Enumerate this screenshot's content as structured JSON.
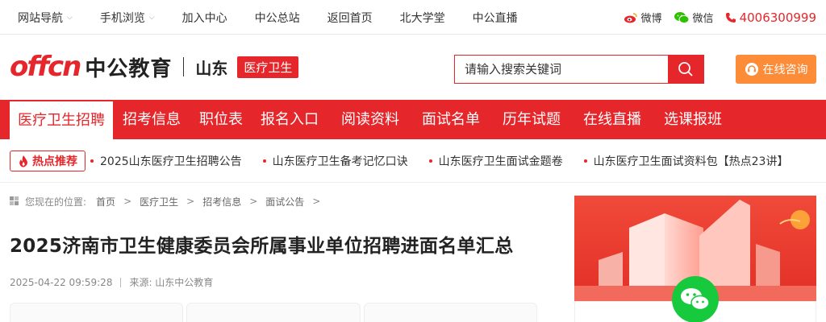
{
  "topbar": {
    "nav": [
      {
        "label": "网站导航",
        "dropdown": true
      },
      {
        "label": "手机浏览",
        "dropdown": true
      },
      {
        "label": "加入中心",
        "dropdown": false
      },
      {
        "label": "中公总站",
        "dropdown": false
      },
      {
        "label": "返回首页",
        "dropdown": false
      },
      {
        "label": "北大学堂",
        "dropdown": false
      },
      {
        "label": "中公直播",
        "dropdown": false
      }
    ],
    "weibo": "微博",
    "wechat": "微信",
    "phone": "4006300999"
  },
  "header": {
    "logo_en": "offcn",
    "logo_cn": "中公教育",
    "province": "山东",
    "tag": "医疗卫生",
    "search_placeholder": "请输入搜索关键词",
    "consult": "在线咨询"
  },
  "mainnav": [
    "医疗卫生招聘",
    "招考信息",
    "职位表",
    "报名入口",
    "阅读资料",
    "面试名单",
    "历年试题",
    "在线直播",
    "选课报班"
  ],
  "hot": {
    "badge": "热点推荐",
    "links": [
      "2025山东医疗卫生招聘公告",
      "山东医疗卫生备考记忆口诀",
      "山东医疗卫生面试金题卷",
      "山东医疗卫生面试资料包【热点23讲】"
    ]
  },
  "breadcrumb": {
    "label": "您现在的位置:",
    "items": [
      "首页",
      "医疗卫生",
      "招考信息",
      "面试公告"
    ]
  },
  "article": {
    "title": "2025济南市卫生健康委员会所属事业单位招聘进面名单汇总",
    "date": "2025-04-22 09:59:28",
    "source": "来源: 山东中公教育"
  },
  "colors": {
    "brand_red": "#e5262b",
    "consult_orange": "#fc8c38",
    "wechat_green": "#17c93d"
  }
}
